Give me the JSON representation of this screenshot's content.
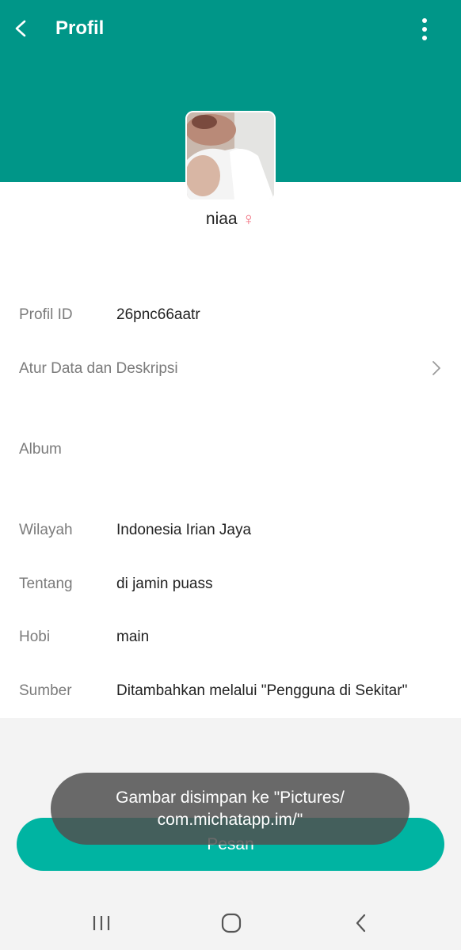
{
  "header": {
    "title": "Profil",
    "background_color": "#009688",
    "back_icon": "chevron-left-icon",
    "menu_icon": "more-vertical-icon"
  },
  "profile": {
    "username": "niaa",
    "gender_symbol": "♀",
    "gender_color": "#f06a7a"
  },
  "details": {
    "profile_id": {
      "label": "Profil ID",
      "value": "26pnc66aatr"
    },
    "manage_data": {
      "label": "Atur Data dan Deskripsi"
    },
    "album": {
      "label": "Album"
    },
    "region": {
      "label": "Wilayah",
      "value": "Indonesia Irian Jaya"
    },
    "about": {
      "label": "Tentang",
      "value": "di jamin puass"
    },
    "hobby": {
      "label": "Hobi",
      "value": "main"
    },
    "source": {
      "label": "Sumber",
      "value": "Ditambahkan melalui \"Pengguna di Sekitar\""
    }
  },
  "actions": {
    "message_label": "Pesan",
    "message_color": "#00b4a2"
  },
  "toast": {
    "line1": "Gambar disimpan ke \"Pictures/",
    "line2": "com.michatapp.im/\""
  },
  "navbar": {
    "recent_icon": "recent-apps-icon",
    "home_icon": "home-icon",
    "back_icon": "back-icon"
  }
}
